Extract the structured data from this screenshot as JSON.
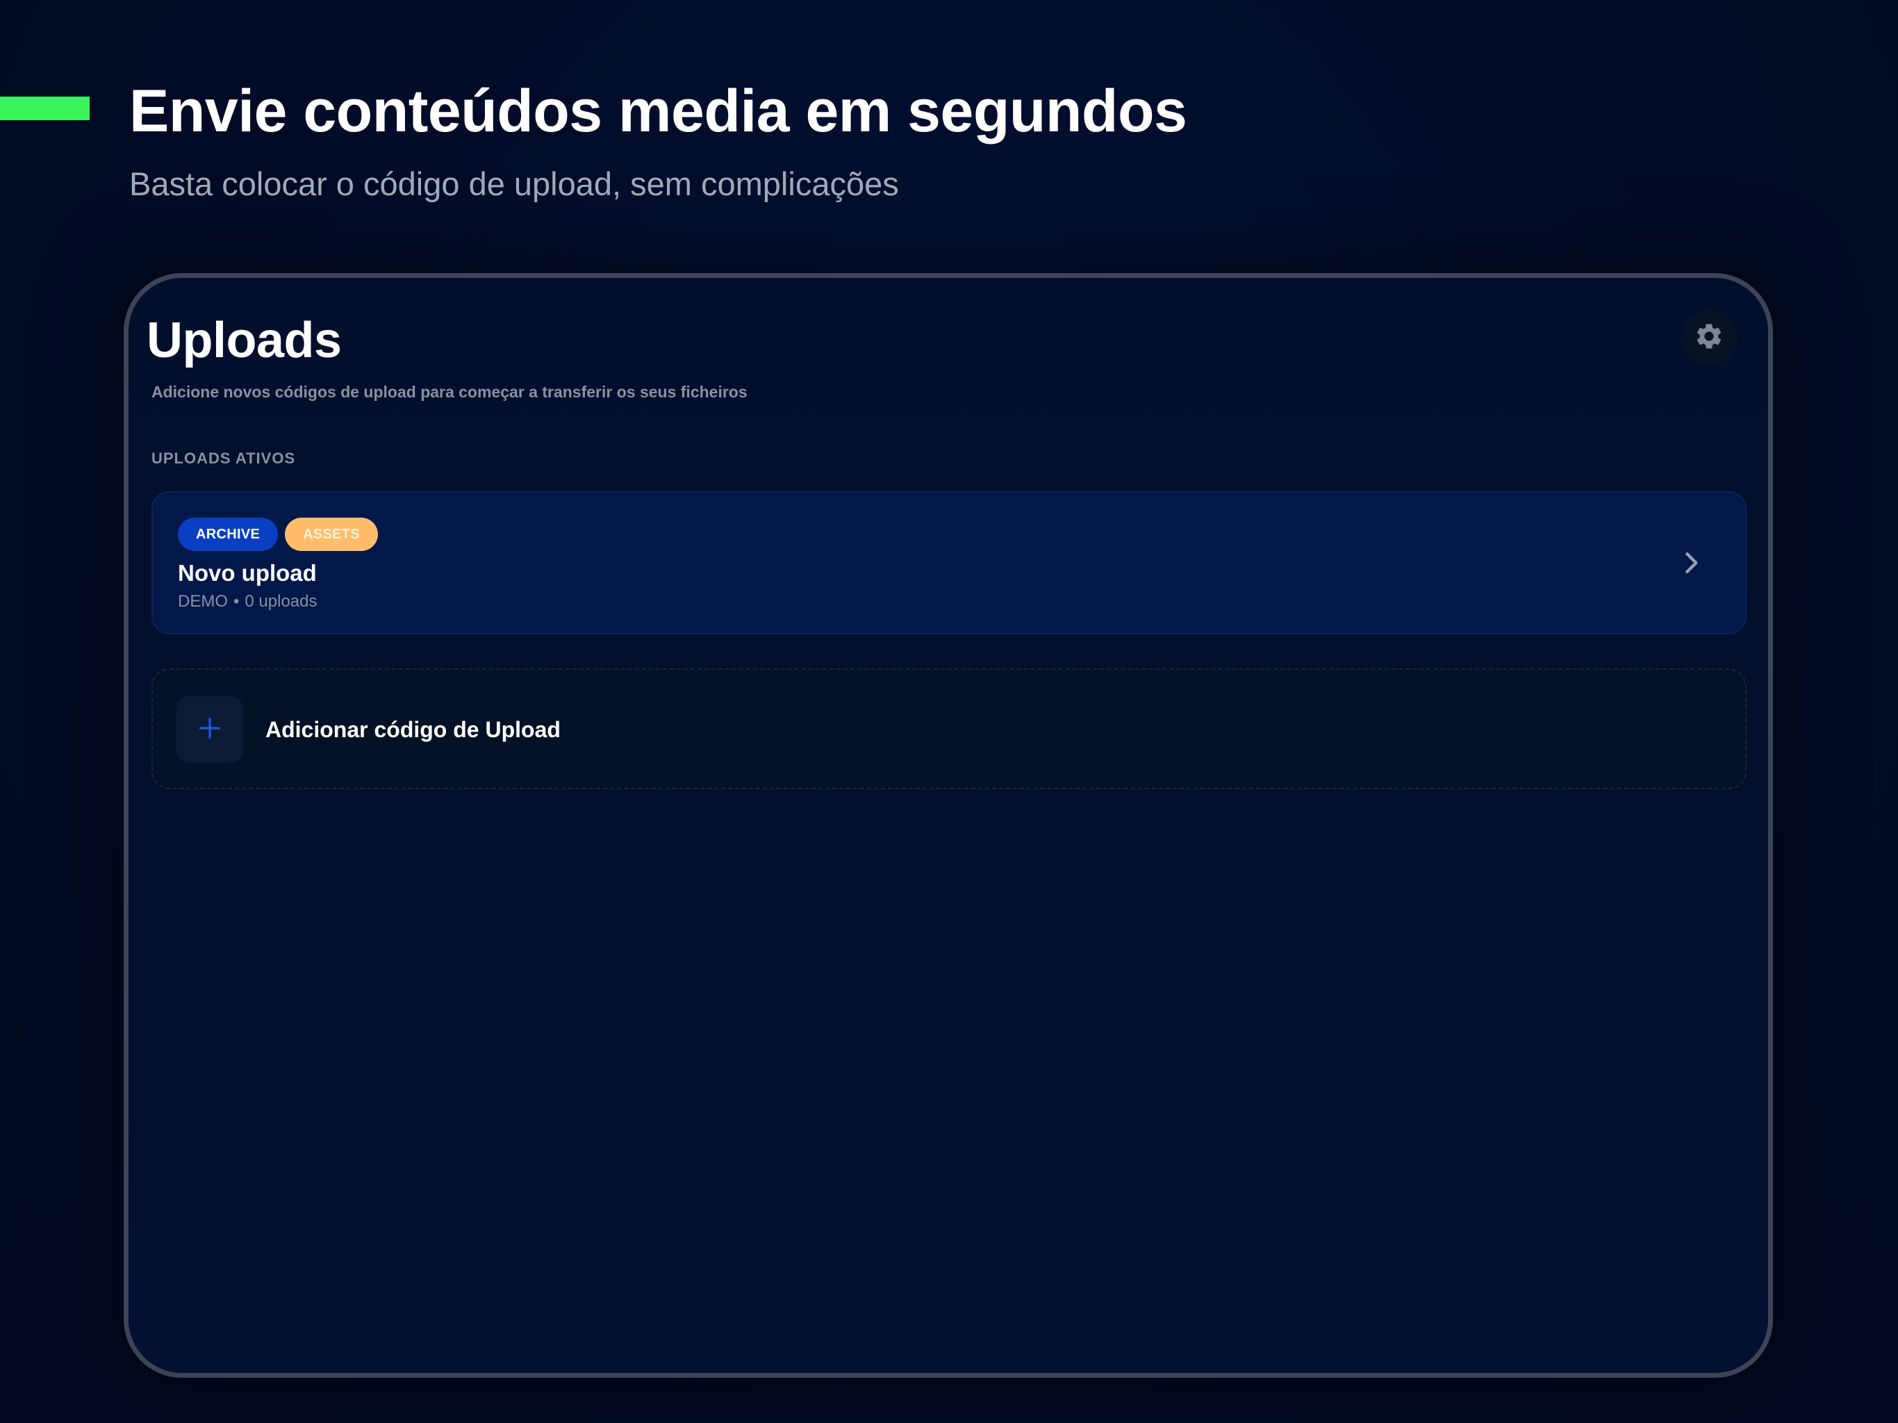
{
  "hero": {
    "title": "Envie conteúdos media em segundos",
    "subtitle": "Basta colocar o código de upload, sem complicações"
  },
  "app": {
    "title": "Uploads",
    "subtitle": "Adicione novos códigos de upload para começar a transferir os seus ficheiros",
    "settings_icon": "gear-icon",
    "section_label": "UPLOADS ATIVOS",
    "uploads": [
      {
        "badges": [
          "ARCHIVE",
          "ASSETS"
        ],
        "name": "Novo upload",
        "code": "DEMO",
        "separator": "•",
        "count": "0 uploads",
        "chevron_icon": "chevron-right-icon"
      }
    ],
    "add_button": {
      "label": "Adicionar código de Upload",
      "icon": "plus-icon"
    }
  },
  "colors": {
    "background": "#020b26",
    "accent": "#3bf45b",
    "card_background": "#021849",
    "badge_archive": "#0a3fc4",
    "badge_assets": "#ffbd6b",
    "muted_text": "#8990a1",
    "device_frame": "#3e4356"
  }
}
